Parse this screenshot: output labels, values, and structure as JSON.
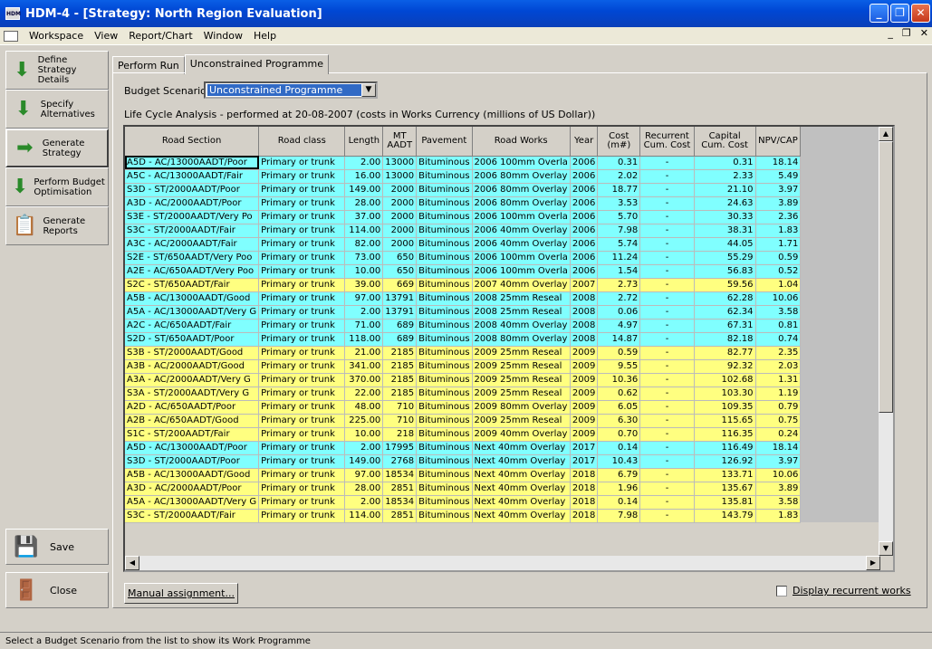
{
  "window": {
    "title": "HDM-4 - [Strategy: North Region Evaluation]",
    "app_icon": "HDM"
  },
  "menu": {
    "items": [
      "Workspace",
      "View",
      "Report/Chart",
      "Window",
      "Help"
    ]
  },
  "nav": [
    {
      "label": "Define Strategy Details",
      "icon": "arrow-down-icon"
    },
    {
      "label": "Specify Alternatives",
      "icon": "arrow-down-icon"
    },
    {
      "label": "Generate Strategy",
      "icon": "arrow-right-icon"
    },
    {
      "label": "Perform Budget Optimisation",
      "icon": "arrow-down-icon"
    },
    {
      "label": "Generate Reports",
      "icon": "report-icon"
    }
  ],
  "save_label": "Save",
  "close_label": "Close",
  "tabs": [
    "Perform Run",
    "Unconstrained Programme"
  ],
  "budget": {
    "label": "Budget Scenario:",
    "value": "Unconstrained Programme"
  },
  "lca_text": "Life Cycle Analysis - performed at 20-08-2007 (costs in Works Currency (millions of US Dollar))",
  "columns": [
    "Road Section",
    "Road class",
    "Length",
    "MT AADT",
    "Pavement",
    "Road Works",
    "Year",
    "Cost (m#)",
    "Recurrent Cum. Cost",
    "Capital Cum. Cost",
    "NPV/CAP"
  ],
  "rows": [
    [
      "A5D - AC/13000AADT/Poor",
      "Primary or trunk",
      "2.00",
      "13000",
      "Bituminous",
      "2006 100mm Overla",
      "2006",
      "0.31",
      "-",
      "0.31",
      "18.14",
      "cyan"
    ],
    [
      "A5C - AC/13000AADT/Fair",
      "Primary or trunk",
      "16.00",
      "13000",
      "Bituminous",
      "2006 80mm Overlay",
      "2006",
      "2.02",
      "-",
      "2.33",
      "5.49",
      "cyan"
    ],
    [
      "S3D - ST/2000AADT/Poor",
      "Primary or trunk",
      "149.00",
      "2000",
      "Bituminous",
      "2006 80mm Overlay",
      "2006",
      "18.77",
      "-",
      "21.10",
      "3.97",
      "cyan"
    ],
    [
      "A3D - AC/2000AADT/Poor",
      "Primary or trunk",
      "28.00",
      "2000",
      "Bituminous",
      "2006 80mm Overlay",
      "2006",
      "3.53",
      "-",
      "24.63",
      "3.89",
      "cyan"
    ],
    [
      "S3E - ST/2000AADT/Very Po",
      "Primary or trunk",
      "37.00",
      "2000",
      "Bituminous",
      "2006 100mm Overla",
      "2006",
      "5.70",
      "-",
      "30.33",
      "2.36",
      "cyan"
    ],
    [
      "S3C - ST/2000AADT/Fair",
      "Primary or trunk",
      "114.00",
      "2000",
      "Bituminous",
      "2006 40mm Overlay",
      "2006",
      "7.98",
      "-",
      "38.31",
      "1.83",
      "cyan"
    ],
    [
      "A3C - AC/2000AADT/Fair",
      "Primary or trunk",
      "82.00",
      "2000",
      "Bituminous",
      "2006 40mm Overlay",
      "2006",
      "5.74",
      "-",
      "44.05",
      "1.71",
      "cyan"
    ],
    [
      "S2E - ST/650AADT/Very Poo",
      "Primary or trunk",
      "73.00",
      "650",
      "Bituminous",
      "2006 100mm Overla",
      "2006",
      "11.24",
      "-",
      "55.29",
      "0.59",
      "cyan"
    ],
    [
      "A2E - AC/650AADT/Very Poo",
      "Primary or trunk",
      "10.00",
      "650",
      "Bituminous",
      "2006 100mm Overla",
      "2006",
      "1.54",
      "-",
      "56.83",
      "0.52",
      "cyan"
    ],
    [
      "S2C - ST/650AADT/Fair",
      "Primary or trunk",
      "39.00",
      "669",
      "Bituminous",
      "2007 40mm Overlay",
      "2007",
      "2.73",
      "-",
      "59.56",
      "1.04",
      "yellow"
    ],
    [
      "A5B - AC/13000AADT/Good",
      "Primary or trunk",
      "97.00",
      "13791",
      "Bituminous",
      "2008 25mm Reseal",
      "2008",
      "2.72",
      "-",
      "62.28",
      "10.06",
      "cyan"
    ],
    [
      "A5A - AC/13000AADT/Very G",
      "Primary or trunk",
      "2.00",
      "13791",
      "Bituminous",
      "2008 25mm Reseal",
      "2008",
      "0.06",
      "-",
      "62.34",
      "3.58",
      "cyan"
    ],
    [
      "A2C - AC/650AADT/Fair",
      "Primary or trunk",
      "71.00",
      "689",
      "Bituminous",
      "2008 40mm Overlay",
      "2008",
      "4.97",
      "-",
      "67.31",
      "0.81",
      "cyan"
    ],
    [
      "S2D - ST/650AADT/Poor",
      "Primary or trunk",
      "118.00",
      "689",
      "Bituminous",
      "2008 80mm Overlay",
      "2008",
      "14.87",
      "-",
      "82.18",
      "0.74",
      "cyan"
    ],
    [
      "S3B - ST/2000AADT/Good",
      "Primary or trunk",
      "21.00",
      "2185",
      "Bituminous",
      "2009 25mm Reseal",
      "2009",
      "0.59",
      "-",
      "82.77",
      "2.35",
      "yellow"
    ],
    [
      "A3B - AC/2000AADT/Good",
      "Primary or trunk",
      "341.00",
      "2185",
      "Bituminous",
      "2009 25mm Reseal",
      "2009",
      "9.55",
      "-",
      "92.32",
      "2.03",
      "yellow"
    ],
    [
      "A3A - AC/2000AADT/Very G",
      "Primary or trunk",
      "370.00",
      "2185",
      "Bituminous",
      "2009 25mm Reseal",
      "2009",
      "10.36",
      "-",
      "102.68",
      "1.31",
      "yellow"
    ],
    [
      "S3A - ST/2000AADT/Very G",
      "Primary or trunk",
      "22.00",
      "2185",
      "Bituminous",
      "2009 25mm Reseal",
      "2009",
      "0.62",
      "-",
      "103.30",
      "1.19",
      "yellow"
    ],
    [
      "A2D - AC/650AADT/Poor",
      "Primary or trunk",
      "48.00",
      "710",
      "Bituminous",
      "2009 80mm Overlay",
      "2009",
      "6.05",
      "-",
      "109.35",
      "0.79",
      "yellow"
    ],
    [
      "A2B - AC/650AADT/Good",
      "Primary or trunk",
      "225.00",
      "710",
      "Bituminous",
      "2009 25mm Reseal",
      "2009",
      "6.30",
      "-",
      "115.65",
      "0.75",
      "yellow"
    ],
    [
      "S1C - ST/200AADT/Fair",
      "Primary or trunk",
      "10.00",
      "218",
      "Bituminous",
      "2009 40mm Overlay",
      "2009",
      "0.70",
      "-",
      "116.35",
      "0.24",
      "yellow"
    ],
    [
      "A5D - AC/13000AADT/Poor",
      "Primary or trunk",
      "2.00",
      "17995",
      "Bituminous",
      "Next 40mm Overlay",
      "2017",
      "0.14",
      "-",
      "116.49",
      "18.14",
      "cyan"
    ],
    [
      "S3D - ST/2000AADT/Poor",
      "Primary or trunk",
      "149.00",
      "2768",
      "Bituminous",
      "Next 40mm Overlay",
      "2017",
      "10.43",
      "-",
      "126.92",
      "3.97",
      "cyan"
    ],
    [
      "A5B - AC/13000AADT/Good",
      "Primary or trunk",
      "97.00",
      "18534",
      "Bituminous",
      "Next 40mm Overlay",
      "2018",
      "6.79",
      "-",
      "133.71",
      "10.06",
      "yellow"
    ],
    [
      "A3D - AC/2000AADT/Poor",
      "Primary or trunk",
      "28.00",
      "2851",
      "Bituminous",
      "Next 40mm Overlay",
      "2018",
      "1.96",
      "-",
      "135.67",
      "3.89",
      "yellow"
    ],
    [
      "A5A - AC/13000AADT/Very G",
      "Primary or trunk",
      "2.00",
      "18534",
      "Bituminous",
      "Next 40mm Overlay",
      "2018",
      "0.14",
      "-",
      "135.81",
      "3.58",
      "yellow"
    ],
    [
      "S3C - ST/2000AADT/Fair",
      "Primary or trunk",
      "114.00",
      "2851",
      "Bituminous",
      "Next 40mm Overlay",
      "2018",
      "7.98",
      "-",
      "143.79",
      "1.83",
      "yellow"
    ]
  ],
  "manual_btn": "Manual assignment...",
  "recurrent_label": "Display recurrent works",
  "status": "Select a Budget Scenario from the list to show its Work Programme",
  "colors": {
    "cyan": "#80ffff",
    "yellow": "#ffff80",
    "title": "#0047d4"
  }
}
